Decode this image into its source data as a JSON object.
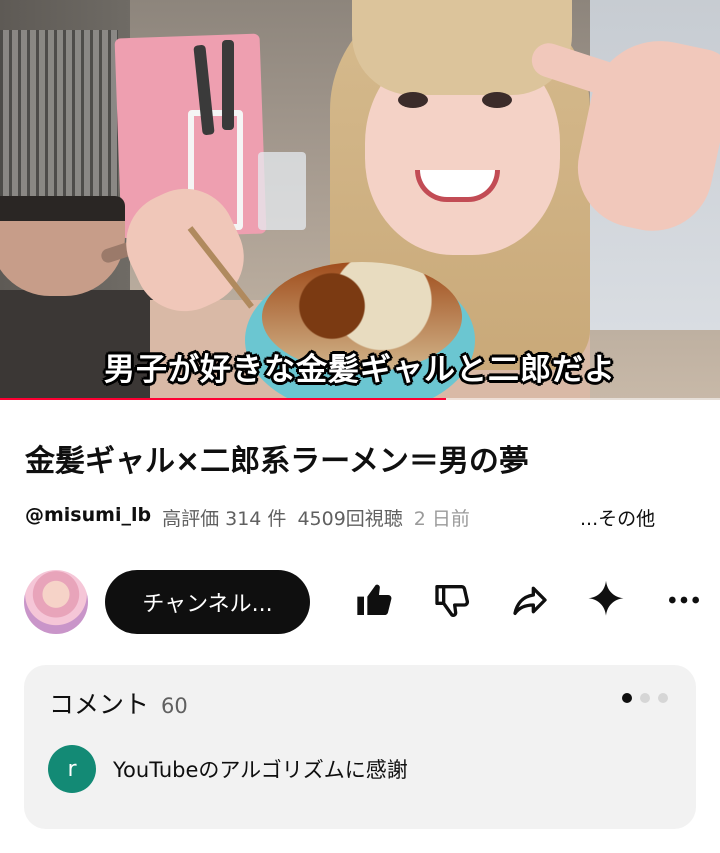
{
  "video": {
    "caption": "男子が好きな金髪ギャルと二郎だよ",
    "progress_fraction": 0.62
  },
  "details": {
    "title": "金髪ギャル×二郎系ラーメン＝男の夢",
    "channel_handle": "@misumi_lb",
    "likes": "高評価 314 件",
    "views": "4509回視聴",
    "age": "2 日前",
    "more": "...その他"
  },
  "actions": {
    "channel_button": "チャンネル...",
    "icons": [
      "like-icon",
      "dislike-icon",
      "share-icon",
      "sparkle-icon",
      "more-icon"
    ]
  },
  "comments": {
    "header": "コメント",
    "count": "60",
    "top_comment": {
      "avatar_letter": "r",
      "text": "YouTubeのアルゴリズムに感謝"
    }
  },
  "colors": {
    "progress": "#ff0033",
    "comment_avatar": "#138a75",
    "button_bg": "#0f0f0f"
  }
}
